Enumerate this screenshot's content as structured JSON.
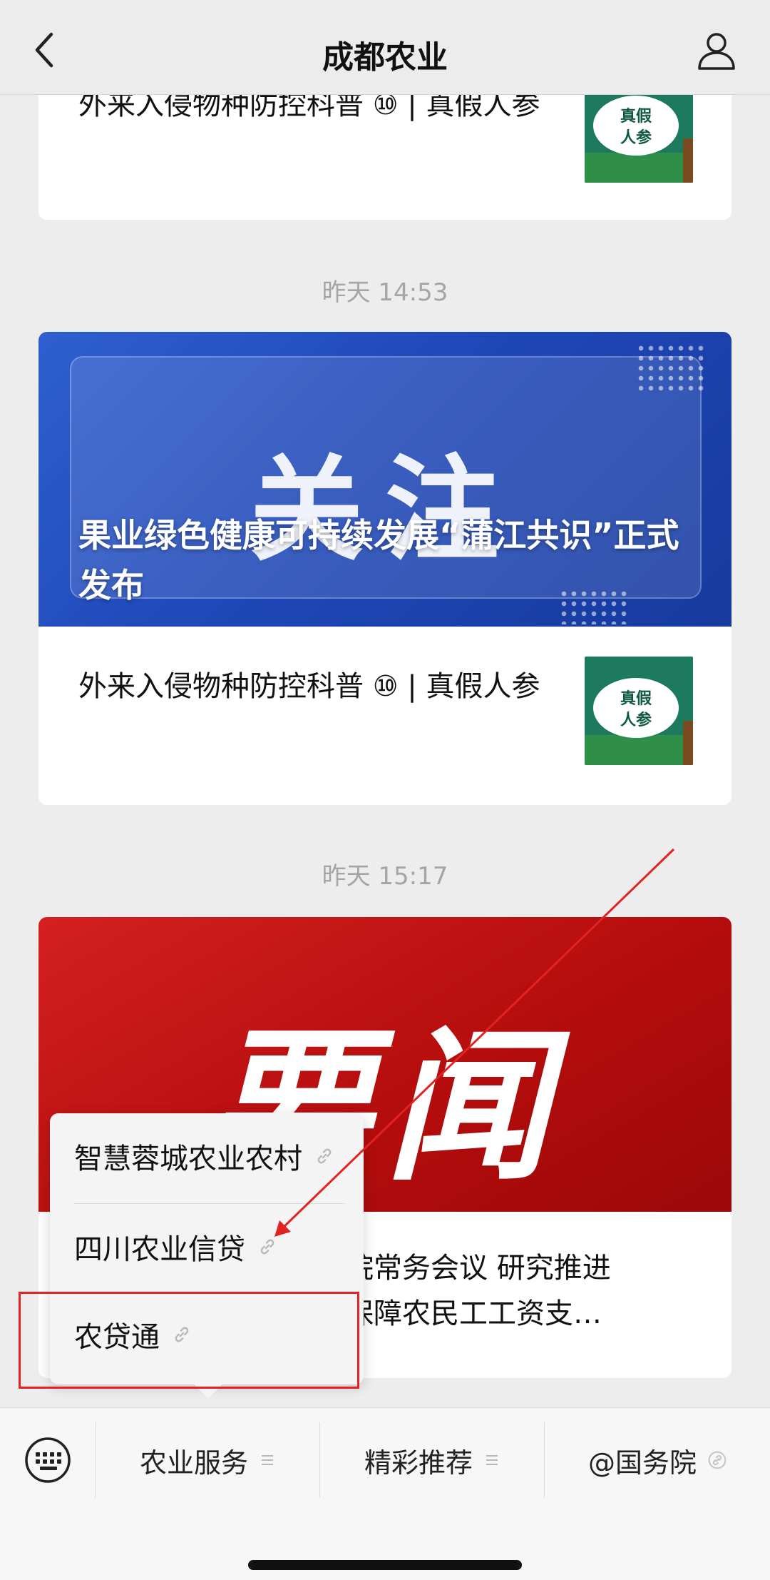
{
  "nav": {
    "title": "成都农业"
  },
  "feed": {
    "item1": {
      "title": "外来入侵物种防控科普 ⑩ | 真假人参",
      "thumb_text_line1": "真假",
      "thumb_text_line2": "人参"
    },
    "timestamp1": "昨天 14:53",
    "card2": {
      "cover_big_text": "关注",
      "cover_headline": "果业绿色健康可持续发展“蒲江共识”正式发布",
      "sub_title": "外来入侵物种防控科普 ⑩ | 真假人参",
      "thumb_text_line1": "真假",
      "thumb_text_line2": "人参"
    },
    "timestamp2": "昨天 15:17",
    "card3": {
      "cover_big_text": "要闻",
      "sub_title_line1": "院常务会议 研究推进",
      "sub_title_line2": "保障农民工工资支…"
    }
  },
  "popup": {
    "items": [
      {
        "label": "智慧蓉城农业农村"
      },
      {
        "label": "四川农业信贷"
      },
      {
        "label": "农贷通"
      }
    ]
  },
  "bottom_menu": {
    "items": [
      {
        "label": "农业服务",
        "icon": "menu-lines-icon"
      },
      {
        "label": "精彩推荐",
        "icon": "menu-lines-icon"
      },
      {
        "label": "@国务院",
        "icon": "link-icon"
      }
    ]
  },
  "colors": {
    "accent_red": "#e32222",
    "blue_cover": "#1f48b8",
    "red_cover": "#b60d0d"
  }
}
